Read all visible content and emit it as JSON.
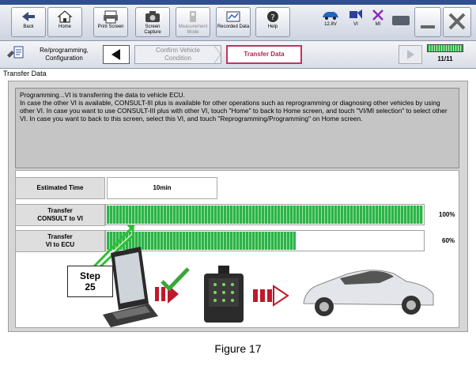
{
  "toolbar": {
    "buttons": [
      {
        "label": "Back",
        "icon": "back-arrow-icon"
      },
      {
        "label": "Home",
        "icon": "home-icon"
      },
      {
        "label": "Print Screen",
        "icon": "printer-icon"
      },
      {
        "label": "Screen Capture",
        "icon": "camera-icon"
      },
      {
        "label": "Measurement Mode",
        "icon": "measurement-icon"
      },
      {
        "label": "Recorded Data",
        "icon": "recorded-data-icon"
      },
      {
        "label": "Help",
        "icon": "help-icon"
      }
    ],
    "status": [
      {
        "label": "12.8V",
        "icon": "battery-car-icon"
      },
      {
        "label": "VI",
        "icon": "vi-icon"
      },
      {
        "label": "MI",
        "icon": "mi-cross-icon"
      }
    ]
  },
  "nav": {
    "mode_label": "Re/programming, Configuration",
    "steps": [
      "Confirm Vehicle Condition",
      "Transfer Data"
    ],
    "page_count": "11/11"
  },
  "section_header": "Transfer Data",
  "message": "Programming...VI is transferring the data to vehicle ECU.\nIn case the other VI is available, CONSULT-III plus is available for other operations such as reprogramming or diagnosing other vehicles by using other VI. In case you want to use CONSULT-III plus with other VI, touch \"Home\" to back to Home screen, and touch \"VI/MI selection\" to select other VI. In case you want to back to this screen, select this VI, and touch \"Reprogramming/Programming\" on Home screen.",
  "estimated": {
    "label": "Estimated Time",
    "value": "10min"
  },
  "transfers": [
    {
      "label": "Transfer\nCONSULT to VI",
      "percent_text": "100%",
      "progress": 1.0
    },
    {
      "label": "Transfer\nVI to ECU",
      "percent_text": "60%",
      "progress": 0.6
    }
  ],
  "step_callout": "Step\n25",
  "figure_caption": "Figure 17",
  "colors": {
    "progress_green": "#2db34a",
    "active_step_border": "#c23363",
    "arrow_red": "#c0182c",
    "check_green": "#3aa63a"
  }
}
